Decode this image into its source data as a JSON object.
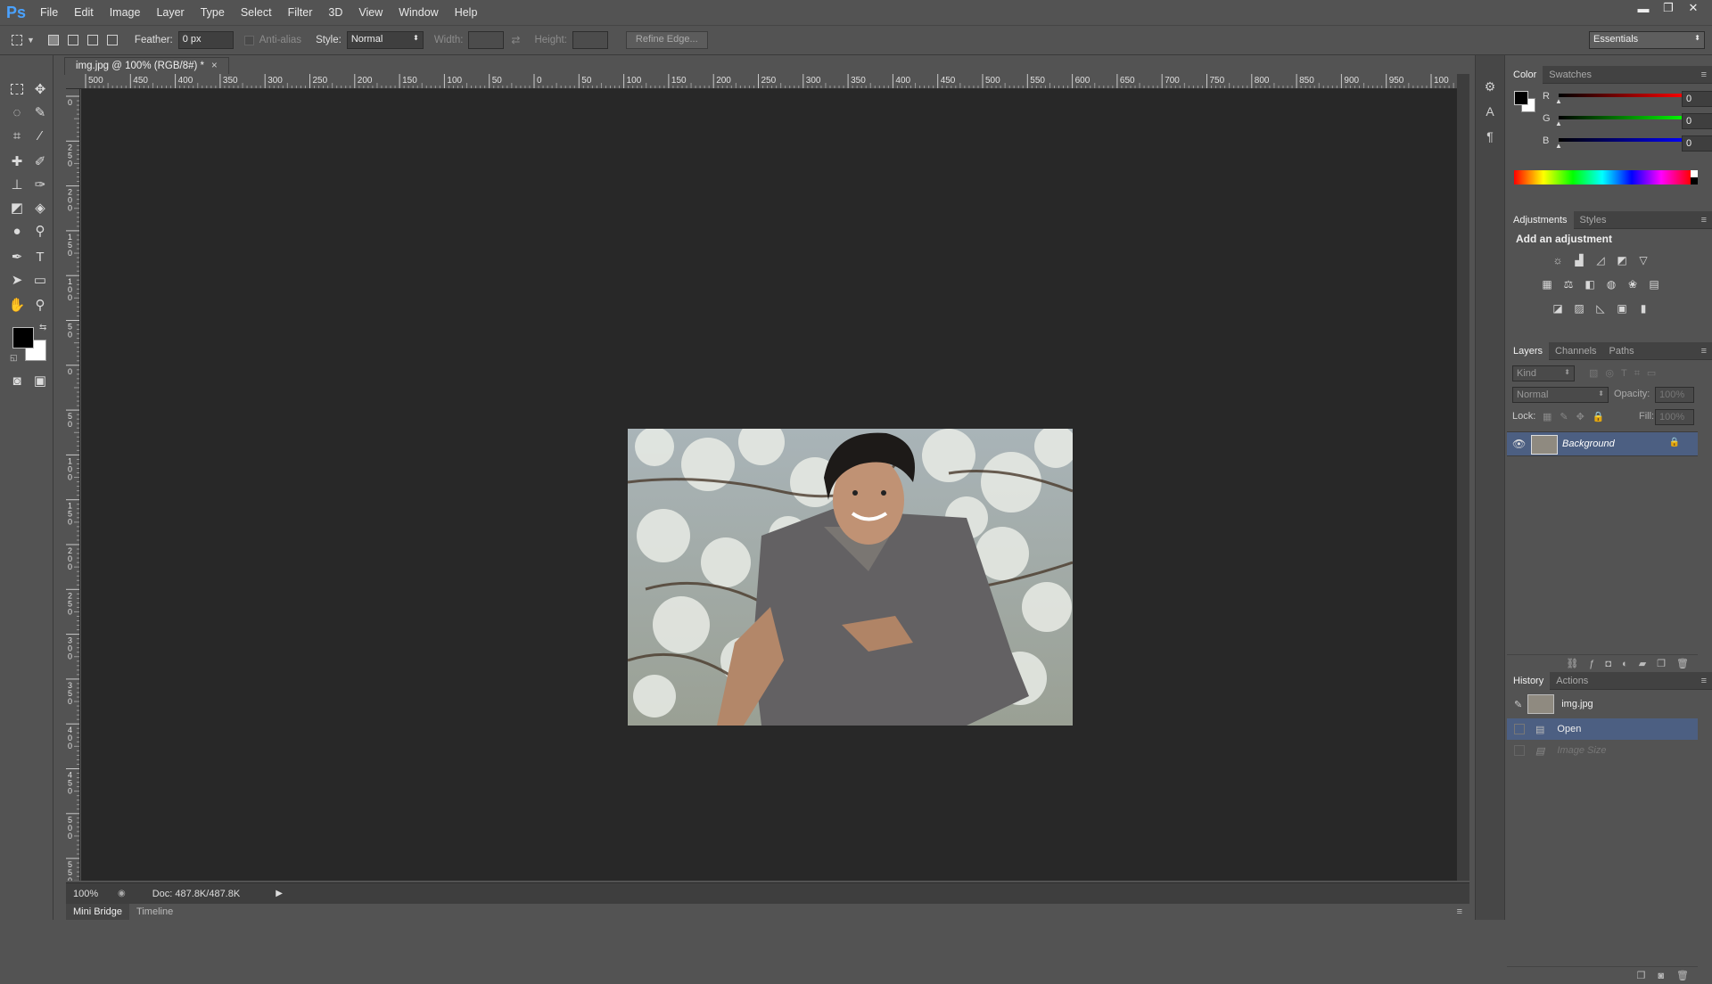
{
  "app": {
    "logo": "Ps"
  },
  "menu": [
    "File",
    "Edit",
    "Image",
    "Layer",
    "Type",
    "Select",
    "Filter",
    "3D",
    "View",
    "Window",
    "Help"
  ],
  "window_controls": {
    "minimize": "▬",
    "restore": "❐",
    "close": "✕"
  },
  "options": {
    "feather_label": "Feather:",
    "feather_value": "0 px",
    "antialias_label": "Anti-alias",
    "style_label": "Style:",
    "style_value": "Normal",
    "width_label": "Width:",
    "height_label": "Height:",
    "refine_edge": "Refine Edge...",
    "workspace": "Essentials"
  },
  "document": {
    "tab_title": "img.jpg @ 100% (RGB/8#) *",
    "close": "×",
    "zoom": "100%",
    "doc_info": "Doc: 487.8K/487.8K"
  },
  "ruler": {
    "h_labels": [
      "500",
      "450",
      "400",
      "350",
      "300",
      "250",
      "200",
      "150",
      "100",
      "50",
      "0",
      "50",
      "100",
      "150",
      "200",
      "250",
      "300",
      "350",
      "400",
      "450",
      "500",
      "550",
      "600",
      "650",
      "700",
      "750",
      "800",
      "850",
      "900",
      "950",
      "100"
    ],
    "v_labels": [
      "0",
      "2 5 0",
      "2 0 0",
      "1 5 0",
      "1 0 0",
      "5 0",
      "0",
      "5 0",
      "1 0 0",
      "1 5 0",
      "2 0 0",
      "2 5 0",
      "3 0 0",
      "3 5 0",
      "4 0 0",
      "4 5 0",
      "5 0 0",
      "5 5 0",
      "6"
    ]
  },
  "bottom_tabs": [
    "Mini Bridge",
    "Timeline"
  ],
  "panels": {
    "color": {
      "tabs": [
        "Color",
        "Swatches"
      ],
      "channels": [
        {
          "label": "R",
          "value": "0"
        },
        {
          "label": "G",
          "value": "0"
        },
        {
          "label": "B",
          "value": "0"
        }
      ]
    },
    "adjustments": {
      "tabs": [
        "Adjustments",
        "Styles"
      ],
      "heading": "Add an adjustment"
    },
    "layers": {
      "tabs": [
        "Layers",
        "Channels",
        "Paths"
      ],
      "kind": "Kind",
      "blend_mode": "Normal",
      "opacity_label": "Opacity:",
      "opacity_value": "100%",
      "lock_label": "Lock:",
      "fill_label": "Fill:",
      "fill_value": "100%",
      "layer_name": "Background"
    },
    "history": {
      "tabs": [
        "History",
        "Actions"
      ],
      "snapshot": "img.jpg",
      "states": [
        "Open",
        "Image Size"
      ]
    }
  },
  "colors": {
    "foreground": "#000000",
    "background": "#ffffff",
    "selection_highlight": "#4c5f82"
  }
}
